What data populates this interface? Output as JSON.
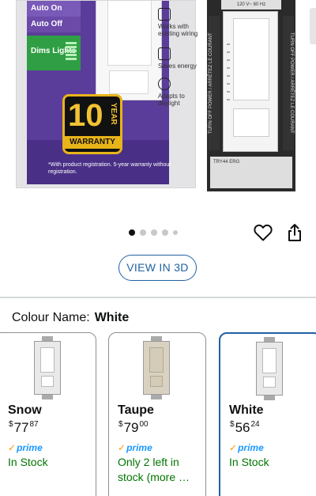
{
  "product_image": {
    "feature_labels": [
      "Auto On",
      "Auto Off",
      "Dims Lights"
    ],
    "warranty": {
      "number": "10",
      "unit": "YEAR",
      "label": "WARRANTY"
    },
    "fine_print": "*With product registration. 5-year warranty without registration.",
    "side_features": [
      "Works with existing wiring",
      "Saves energy",
      "Adapts to daylight"
    ],
    "device_top_text": "120 V~ 60 Hz",
    "device_left_text": "TURN OFF POWER / ARRÊTEZ LE COURANT",
    "device_right_text": "TURN OFF POWER / ARRÊTEZ LE COURANT",
    "device_bottom_text": "TRY44  ERG"
  },
  "carousel": {
    "page_count": 5,
    "active_index": 0
  },
  "icons": {
    "favorite": "heart-icon",
    "share": "share-icon"
  },
  "view_in_3d": {
    "label": "VIEW IN 3D"
  },
  "colour": {
    "label": "Colour Name:",
    "value": "White"
  },
  "variants": [
    {
      "name": "Snow",
      "price_symbol": "$",
      "price_whole": "77",
      "price_fraction": "87",
      "prime": "prime",
      "stock": "In Stock",
      "selected": false
    },
    {
      "name": "Taupe",
      "price_symbol": "$",
      "price_whole": "79",
      "price_fraction": "00",
      "prime": "prime",
      "stock": "Only 2 left in stock (more …",
      "selected": false
    },
    {
      "name": "White",
      "price_symbol": "$",
      "price_whole": "56",
      "price_fraction": "24",
      "prime": "prime",
      "stock": "In Stock",
      "selected": true
    }
  ],
  "colors": {
    "link_blue": "#2162a1",
    "stock_green": "#007600",
    "prime_blue": "#1a98ff",
    "prime_orange": "#ff9900"
  }
}
